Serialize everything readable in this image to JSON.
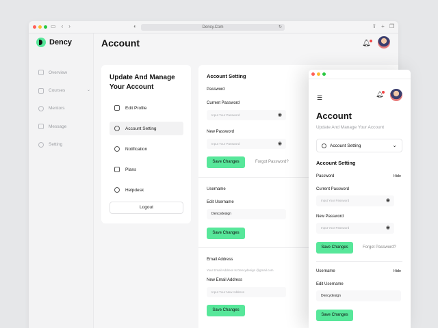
{
  "browser": {
    "url": "Dency.Com"
  },
  "brand": {
    "name": "Dency",
    "accent": "#57e79a"
  },
  "sidebar": {
    "items": [
      {
        "label": "Overview",
        "icon": "grid-icon"
      },
      {
        "label": "Courses",
        "icon": "book-icon"
      },
      {
        "label": "Mentors",
        "icon": "user-icon"
      },
      {
        "label": "Message",
        "icon": "message-icon"
      },
      {
        "label": "Setting",
        "icon": "gear-icon"
      }
    ]
  },
  "header": {
    "title": "Account"
  },
  "settings_menu": {
    "title": "Update And Manage Your Account",
    "items": [
      {
        "label": "Edit Profile",
        "icon": "profile-card-icon"
      },
      {
        "label": "Account Setting",
        "icon": "gear-icon"
      },
      {
        "label": "Notification",
        "icon": "bell-icon"
      },
      {
        "label": "Plans",
        "icon": "plans-icon"
      },
      {
        "label": "Helpdesk",
        "icon": "help-icon"
      }
    ],
    "logout_label": "Logout"
  },
  "account_setting": {
    "title": "Account Setting",
    "password_label": "Password",
    "current_password_label": "Current Password",
    "current_password_placeholder": "Input Your Password",
    "new_password_label": "New Password",
    "new_password_placeholder": "Input Your Password",
    "save_label": "Save Changes",
    "forgot_label": "Forgot Password?",
    "username_label": "Username",
    "edit_username_label": "Edit Username",
    "username_value": "Dencydesign",
    "email_label": "Email Address",
    "email_hint": "Your Email Address Is Dencydesign @gmail.com",
    "new_email_label": "New Email Address",
    "new_email_placeholder": "Input Your New Address"
  },
  "mobile": {
    "title": "Account",
    "subtitle": "Update And Manage Your Account",
    "selected_option": "Account Setting",
    "section_title": "Account Setting",
    "password_label": "Password",
    "hide_label": "Hide",
    "current_password_label": "Current Password",
    "current_password_placeholder": "Input Your Password",
    "new_password_label": "New Password",
    "new_password_placeholder": "Input Your Password",
    "save_label": "Save Changes",
    "forgot_label": "Forgot Password?",
    "username_label": "Username",
    "username_hide_label": "Hide",
    "edit_username_label": "Edit Username",
    "username_value": "Dencydesign"
  }
}
